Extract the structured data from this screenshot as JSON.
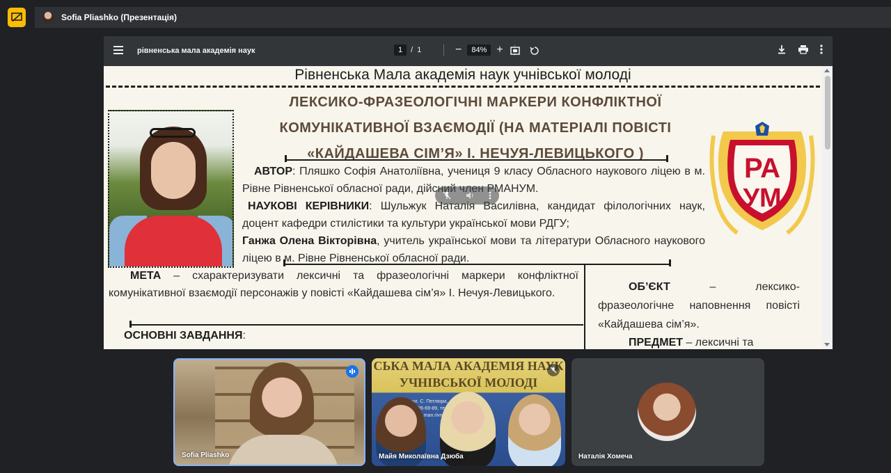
{
  "presenter_bar": {
    "title": "Sofia Pliashko (Презентація)",
    "badge_icon": "present-to-all-icon",
    "badge_color": "#fbbc04"
  },
  "viewer": {
    "doc_title": "рівненська мала академія наук",
    "current_page": "1",
    "page_separator": "/",
    "total_pages": "1",
    "zoom": "84%",
    "zoom_out": "−",
    "zoom_in": "+"
  },
  "poster": {
    "header": "Рівненська Мала академія наук учнівської молоді",
    "topic": "ЛЕКСИКО-ФРАЗЕОЛОГІЧНІ МАРКЕРИ КОНФЛІКТНОЇ КОМУНІКАТИВНОЇ ВЗАЄМОДІЇ (НА МАТЕРІАЛІ ПОВІСТІ «КАЙДАШЕВА СІМ’Я» І. НЕЧУЯ-ЛЕВИЦЬКОГО )",
    "author_label": "АВТОР",
    "author_text": ": Пляшко Софія Анатоліївна, учениця 9 класу Обласного наукового ліцею в м. Рівне Рівненської обласної ради, дійсний член РМАНУМ.",
    "advisors_label": "НАУКОВІ КЕРІВНИКИ",
    "advisor1_text": ": Шульжук Наталія Василівна, кандидат філологічних наук, доцент кафедри стилістики та культури української мови РДГУ;",
    "advisor2_name": "Ганжа Олена Вікторівна",
    "advisor2_text": ", учитель української мови та літератури Обласного наукового ліцею в м. Рівне Рівненської обласної ради.",
    "goal_label": "МЕТА",
    "goal_text": " – схарактеризувати лексичні та фразеологічні маркери конфліктної комунікативної взаємодії персонажів у повісті «Кайдашева сім’я» І. Нечуя-Левицького.",
    "object_label": "ОБ’ЄКТ",
    "object_text": " – лексико-фразеологічне наповнення повісті «Кайдашева сім’я».",
    "subject_label": "ПРЕДМЕТ",
    "subject_text": " – лексичні та",
    "tasks_label": "ОСНОВНІ ЗАВДАННЯ",
    "tasks_colon": ":",
    "crest_letters_top": "РА",
    "crest_letters_bottom": "УМ",
    "crest_colors": {
      "red": "#c8102e",
      "gold": "#f2c94c"
    }
  },
  "participants": [
    {
      "name": "Sofia Pliashko",
      "state": "speaking"
    },
    {
      "name": "Майя Миколаївна Дзюба",
      "state": "muted",
      "banner_line1": "СЬКА МАЛА АКАДЕМІЯ НАУК",
      "banner_line2": "УЧНІВСЬКОЇ МОЛОДІ",
      "banner_small1": "ул. С. Петлюри,",
      "banner_small2": "2) 26-69-89, тел",
      "banner_small3": "mail: man.rivne"
    },
    {
      "name": "Наталія Хомеча",
      "state": "avatar"
    }
  ]
}
